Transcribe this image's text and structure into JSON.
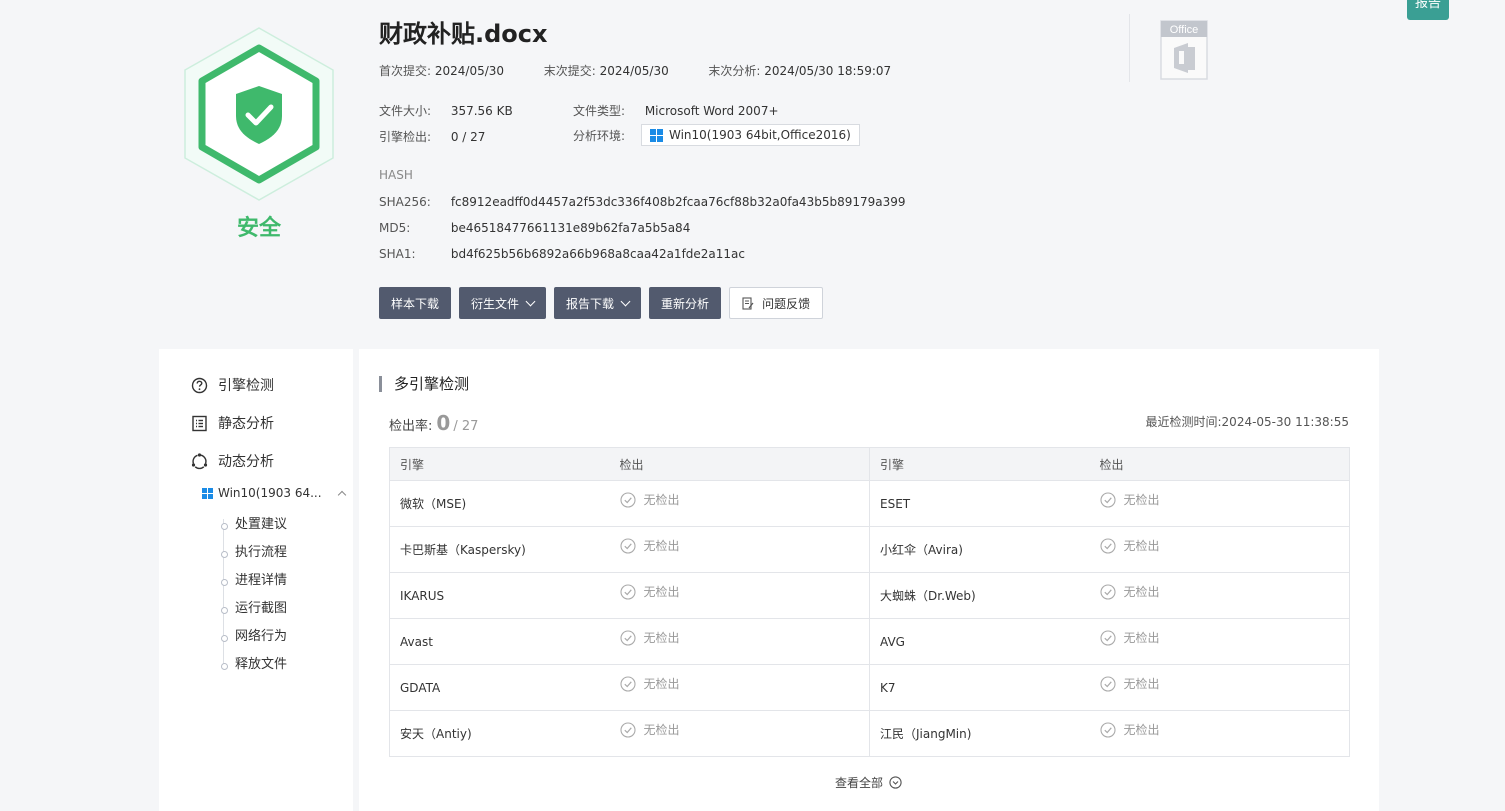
{
  "top_tag": "报告",
  "verdict": {
    "label": "安全",
    "color": "#3fb96c"
  },
  "file": {
    "name": "财政补贴.docx",
    "first_submit_label": "首次提交:",
    "first_submit": "2024/05/30",
    "last_submit_label": "末次提交:",
    "last_submit": "2024/05/30",
    "last_analysis_label": "末次分析:",
    "last_analysis": "2024/05/30 18:59:07",
    "size_label": "文件大小:",
    "size": "357.56 KB",
    "type_label": "文件类型:",
    "type": "Microsoft Word 2007+",
    "engine_label": "引擎检出:",
    "engine": "0 / 27",
    "env_label": "分析环境:",
    "env": "Win10(1903 64bit,Office2016)"
  },
  "hash": {
    "title": "HASH",
    "sha256_label": "SHA256:",
    "sha256": "fc8912eadff0d4457a2f53dc336f408b2fcaa76cf88b32a0fa43b5b89179a399",
    "md5_label": "MD5:",
    "md5": "be46518477661131e89b62fa7a5b5a84",
    "sha1_label": "SHA1:",
    "sha1": "bd4f625b56b6892a66b968a8caa42a1fde2a11ac"
  },
  "actions": {
    "sample_download": "样本下载",
    "derived_files": "衍生文件",
    "report_download": "报告下载",
    "reanalyze": "重新分析",
    "feedback": "问题反馈"
  },
  "office_icon_label": "Office",
  "sidebar": {
    "engine_detection": "引擎检测",
    "static_analysis": "静态分析",
    "dynamic_analysis": "动态分析",
    "env_short": "Win10(1903 64...",
    "sub_items": [
      "处置建议",
      "执行流程",
      "进程详情",
      "运行截图",
      "网络行为",
      "释放文件"
    ]
  },
  "main": {
    "section_title": "多引擎检测",
    "rate_label": "检出率:",
    "rate_value": "0",
    "rate_total": "/ 27",
    "last_time": "最近检测时间:2024-05-30 11:38:55",
    "col_engine": "引擎",
    "col_detect": "检出",
    "result_text": "无检出",
    "rows": [
      {
        "left": "微软（MSE)",
        "right": "ESET"
      },
      {
        "left": "卡巴斯基（Kaspersky)",
        "right": "小红伞（Avira)"
      },
      {
        "left": "IKARUS",
        "right": "大蜘蛛（Dr.Web)"
      },
      {
        "left": "Avast",
        "right": "AVG"
      },
      {
        "left": "GDATA",
        "right": "K7"
      },
      {
        "left": "安天（Antiy)",
        "right": "江民（JiangMin)"
      }
    ],
    "view_all": "查看全部"
  },
  "colors": {
    "accent_dark": "#525a6e",
    "safe_green": "#3fb96c",
    "tag_teal": "#3a9f94"
  }
}
